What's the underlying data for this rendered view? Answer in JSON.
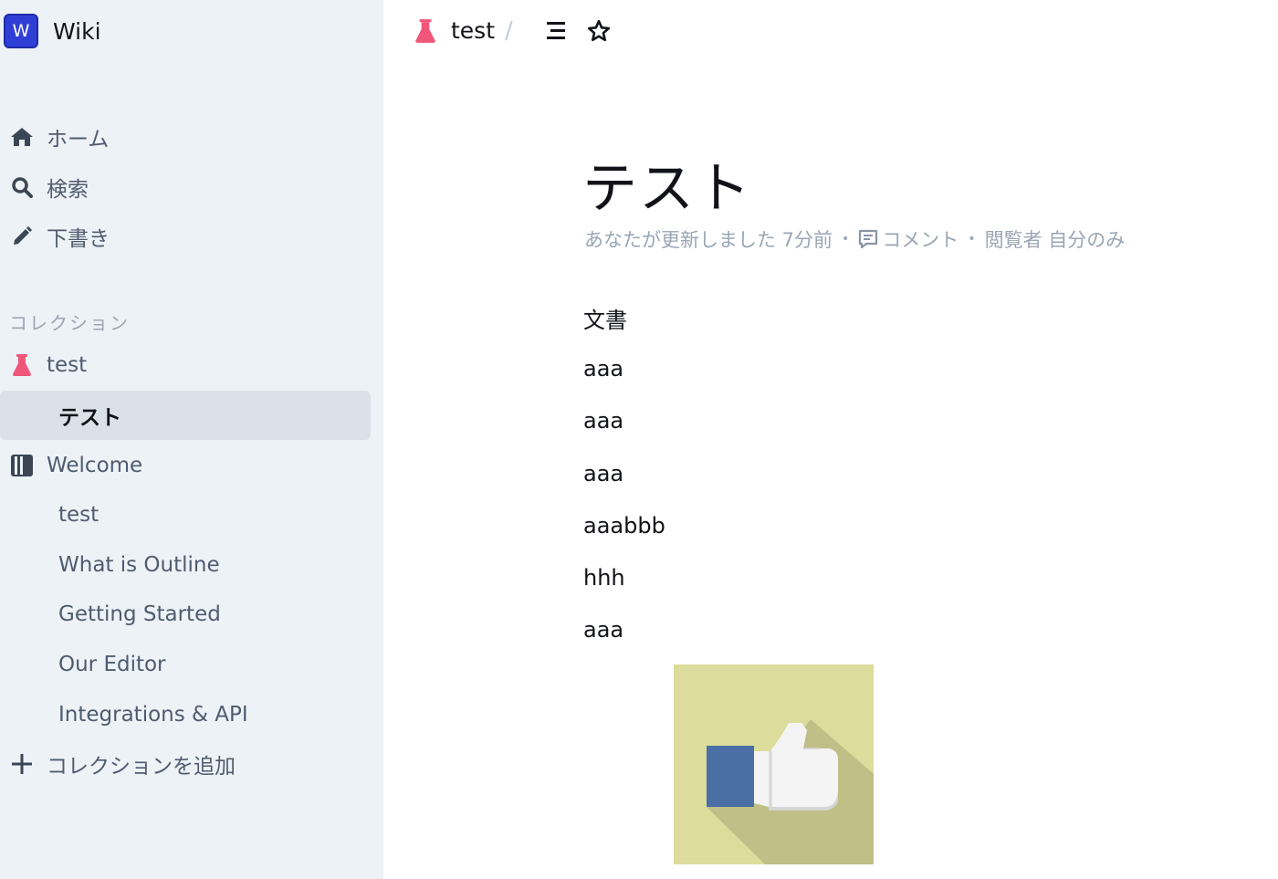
{
  "brand": {
    "logo_letter": "W",
    "name": "Wiki"
  },
  "sidebar": {
    "nav": [
      {
        "label": "ホーム",
        "icon": "home-icon"
      },
      {
        "label": "検索",
        "icon": "search-icon"
      },
      {
        "label": "下書き",
        "icon": "pencil-icon"
      }
    ],
    "section_label": "コレクション",
    "collections": [
      {
        "label": "test",
        "icon": "beaker-icon",
        "icon_color": "#f0567a"
      },
      {
        "label": "テスト",
        "active": true
      },
      {
        "label": "Welcome",
        "icon": "notebook-icon"
      },
      {
        "label": "test"
      },
      {
        "label": "What is Outline"
      },
      {
        "label": "Getting Started"
      },
      {
        "label": "Our Editor"
      },
      {
        "label": "Integrations & API"
      }
    ],
    "add_collection": "コレクションを追加"
  },
  "header": {
    "collection": "test",
    "separator": "/"
  },
  "document": {
    "title": "テスト",
    "meta": {
      "updated": "あなたが更新しました 7分前",
      "comment": "コメント",
      "viewers": "閲覧者 自分のみ",
      "dot": "•"
    },
    "paragraphs": [
      "文書",
      "aaa",
      "aaa",
      "aaa",
      "aaabbb",
      "hhh",
      "aaa"
    ],
    "image_icon": "thumbs-up-icon"
  },
  "colors": {
    "accent": "#2f3fd6",
    "collection_icon": "#f0567a",
    "sidebar_bg": "#edf2f7",
    "active_bg": "#dae1e9",
    "image_bg": "#dcdc9c",
    "image_shadow": "#bfbf87",
    "cuff": "#4a6fa5"
  }
}
